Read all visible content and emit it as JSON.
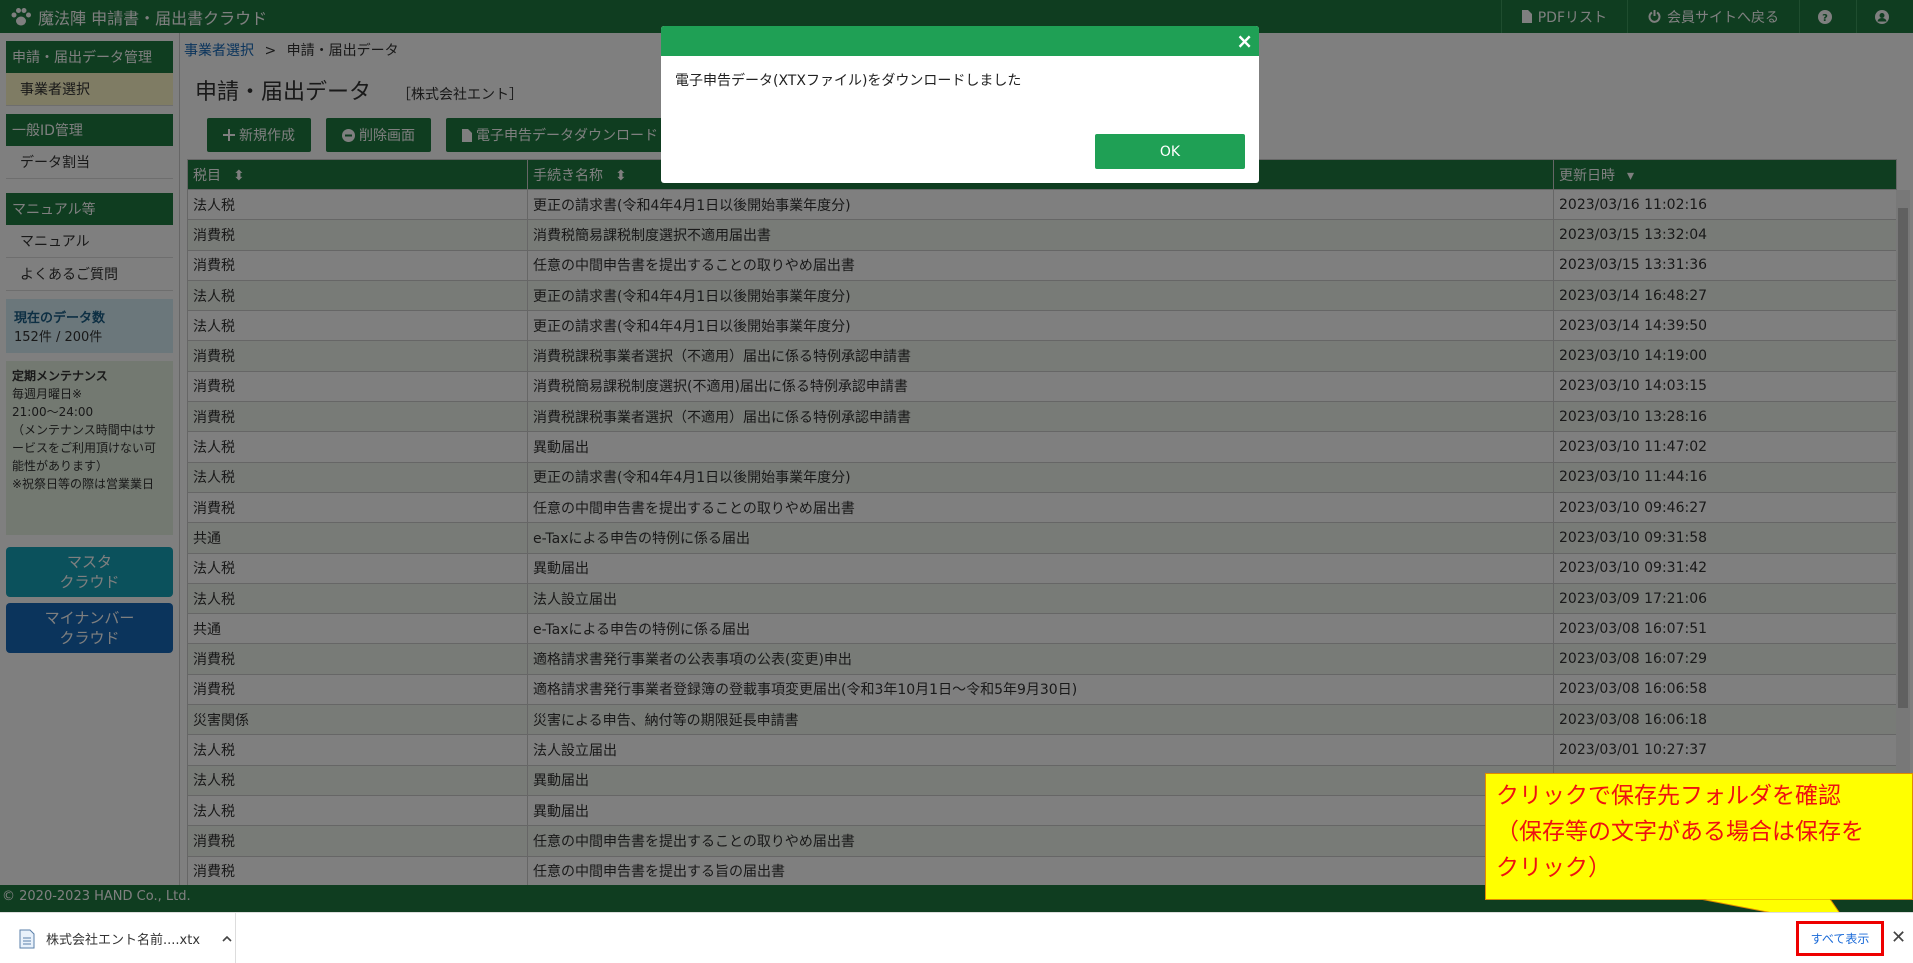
{
  "header": {
    "title": "魔法陣 申請書・届出書クラウド",
    "nav": [
      {
        "label": "PDFリスト"
      },
      {
        "label": "会員サイトへ戻る"
      }
    ]
  },
  "sidebar": {
    "section1_title": "申請・届出データ管理",
    "section1_item": "事業者選択",
    "section2_title": "一般ID管理",
    "section2_item": "データ割当",
    "section3_title": "マニュアル等",
    "section3_items": [
      "マニュアル",
      "よくあるご質問"
    ],
    "data_count_title": "現在のデータ数",
    "data_count_value": "152件  / 200件",
    "maintenance": {
      "title": "定期メンテナンス",
      "line1": "毎週月曜日※",
      "line2": "21:00〜24:00",
      "line3": "（メンテナンス時間中はサービスをご利用頂けない可能性があります）",
      "line4": "※祝祭日等の際は営業業日"
    },
    "btn_master_line1": "マスタ",
    "btn_master_line2": "クラウド",
    "btn_mynumber_line1": "マイナンバー",
    "btn_mynumber_line2": "クラウド"
  },
  "main": {
    "breadcrumb_link": "事業者選択",
    "breadcrumb_sep": ">",
    "breadcrumb_current": "申請・届出データ",
    "page_title": "申請・届出データ",
    "company": "［株式会社エント］",
    "toolbar": {
      "new_label": "新規作成",
      "delete_label": "削除画面",
      "download_label": "電子申告データダウンロード"
    },
    "table": {
      "columns": [
        "税目",
        "手続き名称",
        "更新日時"
      ],
      "rows": [
        [
          "法人税",
          "更正の請求書(令和4年4月1日以後開始事業年度分)",
          "2023/03/16 11:02:16"
        ],
        [
          "消費税",
          "消費税簡易課税制度選択不適用届出書",
          "2023/03/15 13:32:04"
        ],
        [
          "消費税",
          "任意の中間申告書を提出することの取りやめ届出書",
          "2023/03/15 13:31:36"
        ],
        [
          "法人税",
          "更正の請求書(令和4年4月1日以後開始事業年度分)",
          "2023/03/14 16:48:27"
        ],
        [
          "法人税",
          "更正の請求書(令和4年4月1日以後開始事業年度分)",
          "2023/03/14 14:39:50"
        ],
        [
          "消費税",
          "消費税課税事業者選択（不適用）届出に係る特例承認申請書",
          "2023/03/10 14:19:00"
        ],
        [
          "消費税",
          "消費税簡易課税制度選択(不適用)届出に係る特例承認申請書",
          "2023/03/10 14:03:15"
        ],
        [
          "消費税",
          "消費税課税事業者選択（不適用）届出に係る特例承認申請書",
          "2023/03/10 13:28:16"
        ],
        [
          "法人税",
          "異動届出",
          "2023/03/10 11:47:02"
        ],
        [
          "法人税",
          "更正の請求書(令和4年4月1日以後開始事業年度分)",
          "2023/03/10 11:44:16"
        ],
        [
          "消費税",
          "任意の中間申告書を提出することの取りやめ届出書",
          "2023/03/10 09:46:27"
        ],
        [
          "共通",
          "e-Taxによる申告の特例に係る届出",
          "2023/03/10 09:31:58"
        ],
        [
          "法人税",
          "異動届出",
          "2023/03/10 09:31:42"
        ],
        [
          "法人税",
          "法人設立届出",
          "2023/03/09 17:21:06"
        ],
        [
          "共通",
          "e-Taxによる申告の特例に係る届出",
          "2023/03/08 16:07:51"
        ],
        [
          "消費税",
          "適格請求書発行事業者の公表事項の公表(変更)申出",
          "2023/03/08 16:07:29"
        ],
        [
          "消費税",
          "適格請求書発行事業者登録簿の登載事項変更届出(令和3年10月1日〜令和5年9月30日)",
          "2023/03/08 16:06:58"
        ],
        [
          "災害関係",
          "災害による申告、納付等の期限延長申請書",
          "2023/03/08 16:06:18"
        ],
        [
          "法人税",
          "法人設立届出",
          "2023/03/01 10:27:37"
        ],
        [
          "法人税",
          "異動届出",
          ""
        ],
        [
          "法人税",
          "異動届出",
          ""
        ],
        [
          "消費税",
          "任意の中間申告書を提出することの取りやめ届出書",
          ""
        ],
        [
          "消費税",
          "任意の中間申告書を提出する旨の届出書",
          ""
        ]
      ]
    }
  },
  "footer": {
    "copyright": "© 2020-2023 HAND Co., Ltd."
  },
  "modal": {
    "message": "電子申告データ(XTXファイル)をダウンロードしました",
    "ok_label": "OK",
    "close_glyph": "×"
  },
  "callout": {
    "line1": "クリックで保存先フォルダを確認",
    "line2": "（保存等の文字がある場合は保存を",
    "line3": "クリック）"
  },
  "download_bar": {
    "filename": "株式会社エント名前....xtx",
    "show_all": "すべて表示",
    "close_glyph": "✕"
  },
  "colors": {
    "brand_green": "#1e7b40",
    "modal_green": "#1fa055",
    "callout_yellow": "#ffff00",
    "callout_text": "#e11111",
    "highlight_red": "#e00000"
  }
}
